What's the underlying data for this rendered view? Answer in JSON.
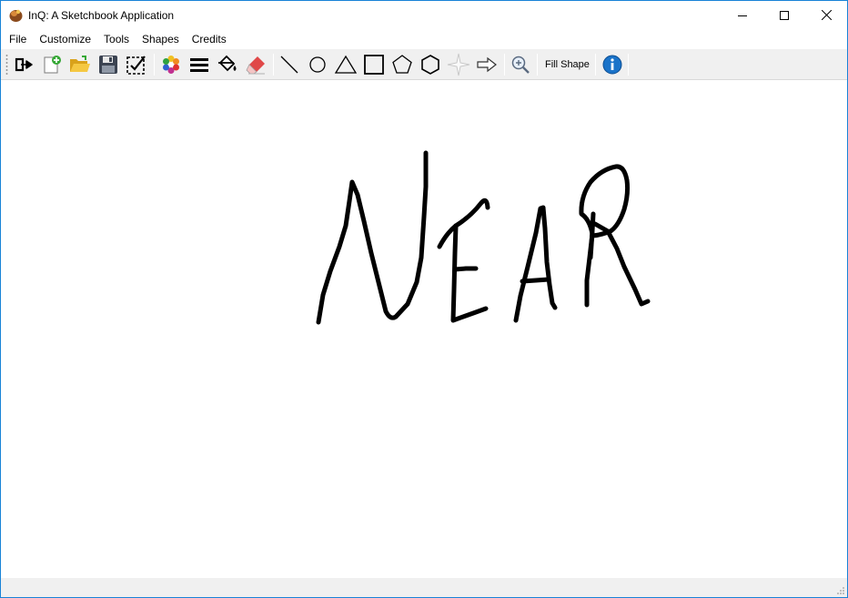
{
  "window": {
    "title": "InQ: A Sketchbook Application",
    "app_icon": "inq-app-icon",
    "controls": [
      "minimize-icon",
      "maximize-icon",
      "close-icon"
    ]
  },
  "menu": {
    "items": [
      "File",
      "Customize",
      "Tools",
      "Shapes",
      "Credits"
    ]
  },
  "toolbar": {
    "tools": [
      "exit-icon",
      "new-file-icon",
      "open-folder-icon",
      "save-icon",
      "select-region-icon",
      "color-palette-icon",
      "line-width-icon",
      "fill-bucket-icon",
      "eraser-icon",
      "line-shape-icon",
      "circle-shape-icon",
      "triangle-shape-icon",
      "square-shape-icon",
      "pentagon-shape-icon",
      "hexagon-shape-icon",
      "star-shape-icon",
      "arrow-shape-icon",
      "zoom-in-icon",
      "info-icon"
    ],
    "fill_shape_label": "Fill Shape"
  },
  "canvas": {
    "drawn_text": "NEAR",
    "stroke_color": "#000000",
    "background": "#ffffff"
  },
  "colors": {
    "window_border": "#1883d7",
    "toolbar_bg": "#f0f0f0",
    "info_blue": "#1a73c9"
  }
}
